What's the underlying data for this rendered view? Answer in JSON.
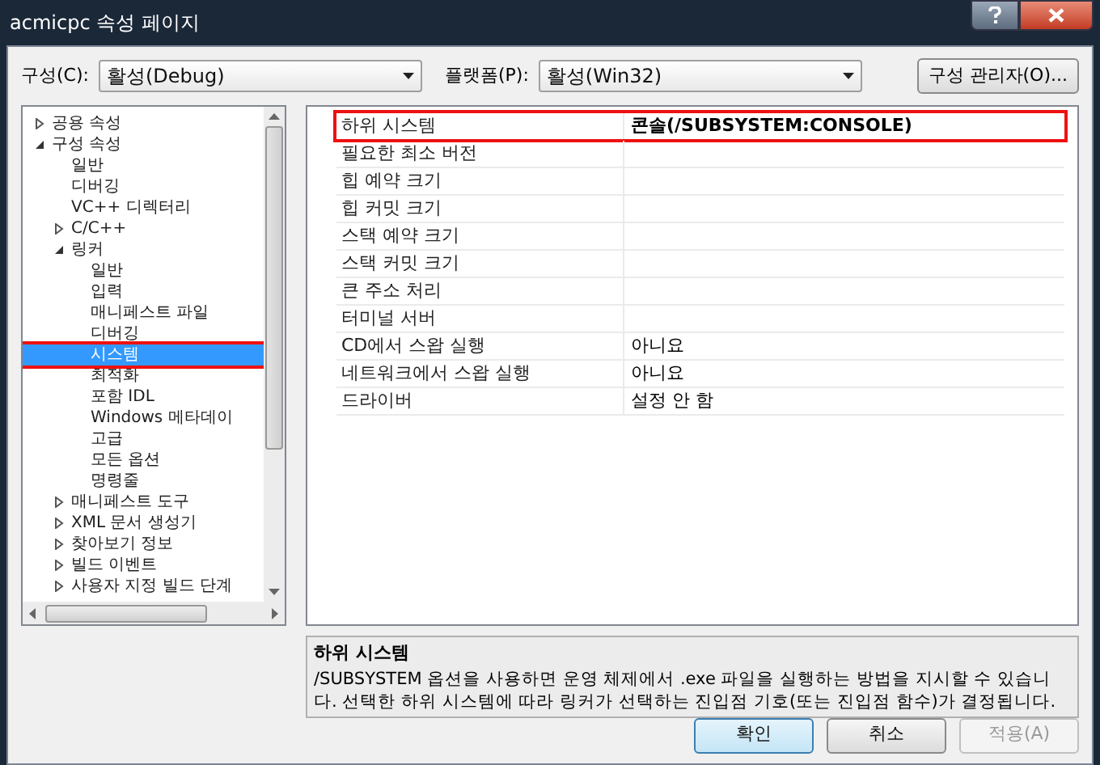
{
  "window": {
    "title": "acmicpc 속성 페이지"
  },
  "configuration": {
    "label": "구성(C):",
    "value": "활성(Debug)"
  },
  "platform": {
    "label": "플랫폼(P):",
    "value": "활성(Win32)"
  },
  "config_manager_button": "구성 관리자(O)...",
  "tree": [
    {
      "label": "공용 속성",
      "expanded": false,
      "selected": false,
      "annotated": false
    },
    {
      "label": "구성 속성",
      "expanded": true,
      "selected": false,
      "annotated": false,
      "children": [
        {
          "label": "일반",
          "selected": false,
          "annotated": false
        },
        {
          "label": "디버깅",
          "selected": false,
          "annotated": false
        },
        {
          "label": "VC++ 디렉터리",
          "selected": false,
          "annotated": false
        },
        {
          "label": "C/C++",
          "expanded": false,
          "selected": false,
          "annotated": false
        },
        {
          "label": "링커",
          "expanded": true,
          "selected": false,
          "annotated": false,
          "children": [
            {
              "label": "일반",
              "selected": false,
              "annotated": false
            },
            {
              "label": "입력",
              "selected": false,
              "annotated": false
            },
            {
              "label": "매니페스트 파일",
              "selected": false,
              "annotated": false
            },
            {
              "label": "디버깅",
              "selected": false,
              "annotated": false
            },
            {
              "label": "시스템",
              "selected": true,
              "annotated": true
            },
            {
              "label": "최적화",
              "selected": false,
              "annotated": false
            },
            {
              "label": "포함 IDL",
              "selected": false,
              "annotated": false
            },
            {
              "label": "Windows 메타데이",
              "selected": false,
              "annotated": false
            },
            {
              "label": "고급",
              "selected": false,
              "annotated": false
            },
            {
              "label": "모든 옵션",
              "selected": false,
              "annotated": false
            },
            {
              "label": "명령줄",
              "selected": false,
              "annotated": false
            }
          ]
        },
        {
          "label": "매니페스트 도구",
          "expanded": false,
          "selected": false,
          "annotated": false
        },
        {
          "label": "XML 문서 생성기",
          "expanded": false,
          "selected": false,
          "annotated": false
        },
        {
          "label": "찾아보기 정보",
          "expanded": false,
          "selected": false,
          "annotated": false
        },
        {
          "label": "빌드 이벤트",
          "expanded": false,
          "selected": false,
          "annotated": false
        },
        {
          "label": "사용자 지정 빌드 단계",
          "expanded": false,
          "selected": false,
          "annotated": false
        }
      ]
    }
  ],
  "properties": [
    {
      "name": "하위 시스템",
      "value": "콘솔(/SUBSYSTEM:CONSOLE)",
      "annotated": true
    },
    {
      "name": "필요한 최소 버전",
      "annotated": false
    },
    {
      "name": "힙 예약 크기",
      "annotated": false
    },
    {
      "name": "힙 커밋 크기",
      "annotated": false
    },
    {
      "name": "스택 예약 크기",
      "annotated": false
    },
    {
      "name": "스택 커밋 크기",
      "annotated": false
    },
    {
      "name": "큰 주소 처리",
      "annotated": false
    },
    {
      "name": "터미널 서버",
      "annotated": false
    },
    {
      "name": "CD에서 스왑 실행",
      "value": "아니요",
      "annotated": false
    },
    {
      "name": "네트워크에서 스왑 실행",
      "value": "아니요",
      "annotated": false
    },
    {
      "name": "드라이버",
      "value": "설정 안 함",
      "annotated": false
    }
  ],
  "description": {
    "title": "하위 시스템",
    "text": "/SUBSYSTEM 옵션을 사용하면 운영 체제에서 .exe 파일을 실행하는 방법을 지시할 수 있습니다. 선택한 하위 시스템에 따라 링커가 선택하는 진입점 기호(또는 진입점 함수)가 결정됩니다."
  },
  "buttons": [
    {
      "label": "확인",
      "default": true,
      "disabled": false
    },
    {
      "label": "취소",
      "default": false,
      "disabled": false
    },
    {
      "label": "적용(A)",
      "default": false,
      "disabled": true
    }
  ]
}
